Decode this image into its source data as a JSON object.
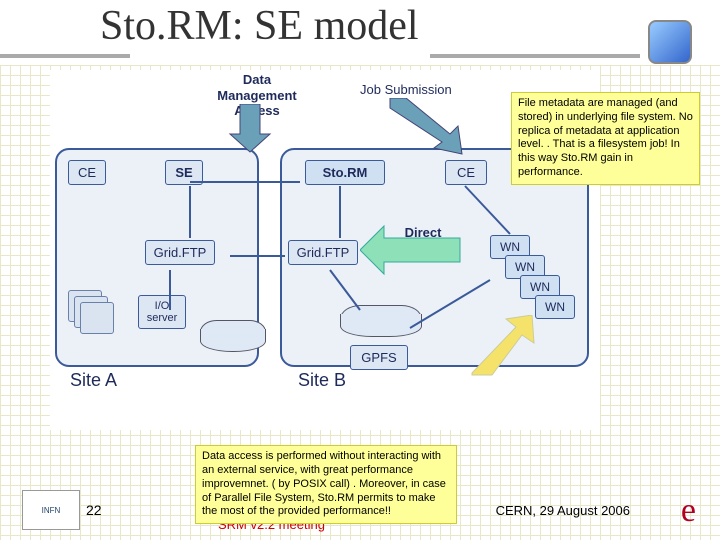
{
  "title": "Sto.RM: SE model",
  "diagram": {
    "data_mgmt": "Data\nManagement\nAccess",
    "job_submission": "Job Submission",
    "ce": "CE",
    "se": "SE",
    "storm": "Sto.RM",
    "gridftp": "Grid.FTP",
    "io_server": "I/O\nserver",
    "direct_access": "Direct\nAccess",
    "gpfs": "GPFS",
    "wn": "WN",
    "site_a": "Site A",
    "site_b": "Site B"
  },
  "callouts": {
    "right": "File metadata are managed (and stored) in underlying file system. No replica of metadata at application level. . That is a filesystem job! In this way Sto.RM gain in performance.",
    "bottom": "Data access is performed without interacting with an external service, with great performance improvemnet. ( by POSIX call) . Moreover, in case of Parallel File System, Sto.RM permits to make the most of the provided performance!!"
  },
  "footer": {
    "slide": "22",
    "center": "SRM v2.2 meeting",
    "right": "CERN,  29 August 2006"
  },
  "icons": {
    "swirl": "swirl",
    "infn": "INFN",
    "e": "e"
  }
}
